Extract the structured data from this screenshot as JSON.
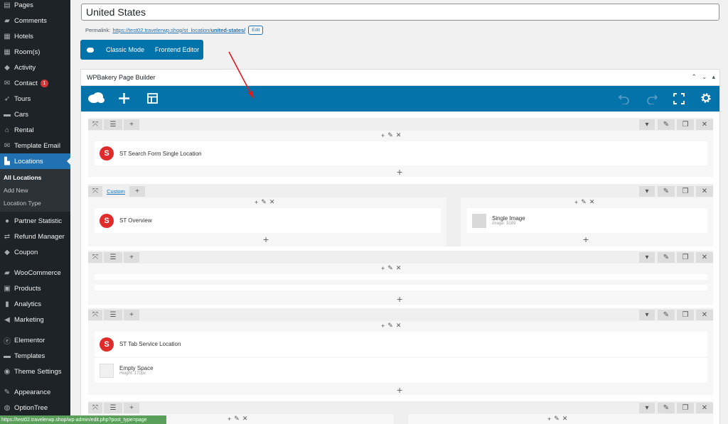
{
  "sidebar": {
    "items": [
      {
        "label": "Pages",
        "icon": "pages-icon",
        "glyph": "▤",
        "active": false
      },
      {
        "label": "Comments",
        "icon": "comments-icon",
        "glyph": "▰",
        "active": false
      },
      {
        "label": "Hotels",
        "icon": "hotels-icon",
        "glyph": "▦",
        "active": false
      },
      {
        "label": "Room(s)",
        "icon": "rooms-icon",
        "glyph": "▦",
        "active": false
      },
      {
        "label": "Activity",
        "icon": "activity-icon",
        "glyph": "◆",
        "active": false
      },
      {
        "label": "Contact",
        "icon": "contact-icon",
        "glyph": "✉",
        "active": false,
        "badge": "1"
      },
      {
        "label": "Tours",
        "icon": "tours-icon",
        "glyph": "➶",
        "active": false
      },
      {
        "label": "Cars",
        "icon": "cars-icon",
        "glyph": "▬",
        "active": false
      },
      {
        "label": "Rental",
        "icon": "rental-icon",
        "glyph": "⌂",
        "active": false
      },
      {
        "label": "Template Email",
        "icon": "email-icon",
        "glyph": "✉",
        "active": false
      },
      {
        "label": "Locations",
        "icon": "locations-icon",
        "glyph": "▙",
        "active": true
      }
    ],
    "sub_items": [
      {
        "label": "All Locations",
        "current": true
      },
      {
        "label": "Add New",
        "current": false
      },
      {
        "label": "Location Type",
        "current": false
      }
    ],
    "items2": [
      {
        "label": "Partner Statistic",
        "icon": "user-icon",
        "glyph": "●"
      },
      {
        "label": "Refund Manager",
        "icon": "shuffle-icon",
        "glyph": "⇄"
      },
      {
        "label": "Coupon",
        "icon": "tag-icon",
        "glyph": "◆"
      },
      {
        "label": "WooCommerce",
        "icon": "woocommerce-icon",
        "glyph": "▰"
      },
      {
        "label": "Products",
        "icon": "products-icon",
        "glyph": "▣"
      },
      {
        "label": "Analytics",
        "icon": "analytics-icon",
        "glyph": "▮"
      },
      {
        "label": "Marketing",
        "icon": "marketing-icon",
        "glyph": "◀"
      },
      {
        "label": "Elementor",
        "icon": "elementor-icon",
        "glyph": "ⓔ"
      },
      {
        "label": "Templates",
        "icon": "folder-icon",
        "glyph": "▬"
      },
      {
        "label": "Theme Settings",
        "icon": "settings-icon",
        "glyph": "◉"
      },
      {
        "label": "Appearance",
        "icon": "brush-icon",
        "glyph": "✎"
      },
      {
        "label": "OptionTree",
        "icon": "optiontree-icon",
        "glyph": "◍"
      }
    ]
  },
  "post": {
    "title": "United States",
    "permalink_label": "Permalink:",
    "permalink_base": "https://test02.travelerwp.shop/st_location/",
    "permalink_slug": "united-states/",
    "edit_label": "Edit"
  },
  "modes": {
    "classic": "Classic Mode",
    "frontend": "Frontend Editor"
  },
  "wpb": {
    "title": "WPBakery Page Builder",
    "rows": {
      "r2_layout_label": "Custom"
    },
    "elements": {
      "search_form": "ST Search Form Single Location",
      "overview": "ST Overview",
      "single_image": "Single Image",
      "single_image_sub": "Image: 9189",
      "tab_service": "ST Tab Service Location",
      "empty_space": "Empty Space",
      "empty_space_sub": "Height: 170px"
    }
  },
  "status_url": "https://test02.travelerwp.shop/wp-admin/edit.php?post_type=page",
  "colors": {
    "wp_blue": "#2271b1",
    "wpb_blue": "#0473aa",
    "admin_dark": "#1d2327",
    "st_red": "#e02b2b"
  }
}
